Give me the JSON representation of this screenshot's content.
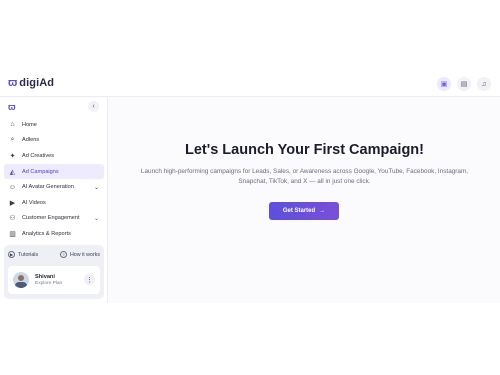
{
  "brand": {
    "name": "digiAd",
    "mark": "ϖ"
  },
  "topbar": {
    "icons": [
      "gallery-icon",
      "chat-icon",
      "bell-icon"
    ]
  },
  "sidebar": {
    "collapse_icon": "‹",
    "items": [
      {
        "label": "Home",
        "icon": "home-icon",
        "glyph": "⌂"
      },
      {
        "label": "Adlens",
        "icon": "search-icon",
        "glyph": "⌕"
      },
      {
        "label": "Ad Creatives",
        "icon": "sparkle-icon",
        "glyph": "✦"
      },
      {
        "label": "Ad Campaigns",
        "icon": "megaphone-icon",
        "glyph": "◭",
        "active": true
      },
      {
        "label": "AI Avatar Generation",
        "icon": "avatar-icon",
        "glyph": "☺",
        "expand": "⌄"
      },
      {
        "label": "AI Videos",
        "icon": "video-icon",
        "glyph": "▶"
      },
      {
        "label": "Customer Engagement",
        "icon": "users-icon",
        "glyph": "⚇",
        "expand": "⌄"
      },
      {
        "label": "Analytics & Reports",
        "icon": "chart-icon",
        "glyph": "▥"
      }
    ],
    "help": {
      "tutorials": "Tutorials",
      "how_it_works": "How it works"
    },
    "user": {
      "name": "Shivani",
      "plan": "Explore Plan"
    }
  },
  "main": {
    "headline": "Let's Launch Your First Campaign!",
    "subtitle": "Launch high-performing campaigns for Leads, Sales, or Awareness across Google, YouTube, Facebook, Instagram, Snapchat, TikTok, and X — all in just one click.",
    "cta_label": "Get Started",
    "cta_arrow": "→"
  },
  "colors": {
    "accent": "#5c50dc",
    "active_bg": "#eeebff"
  }
}
